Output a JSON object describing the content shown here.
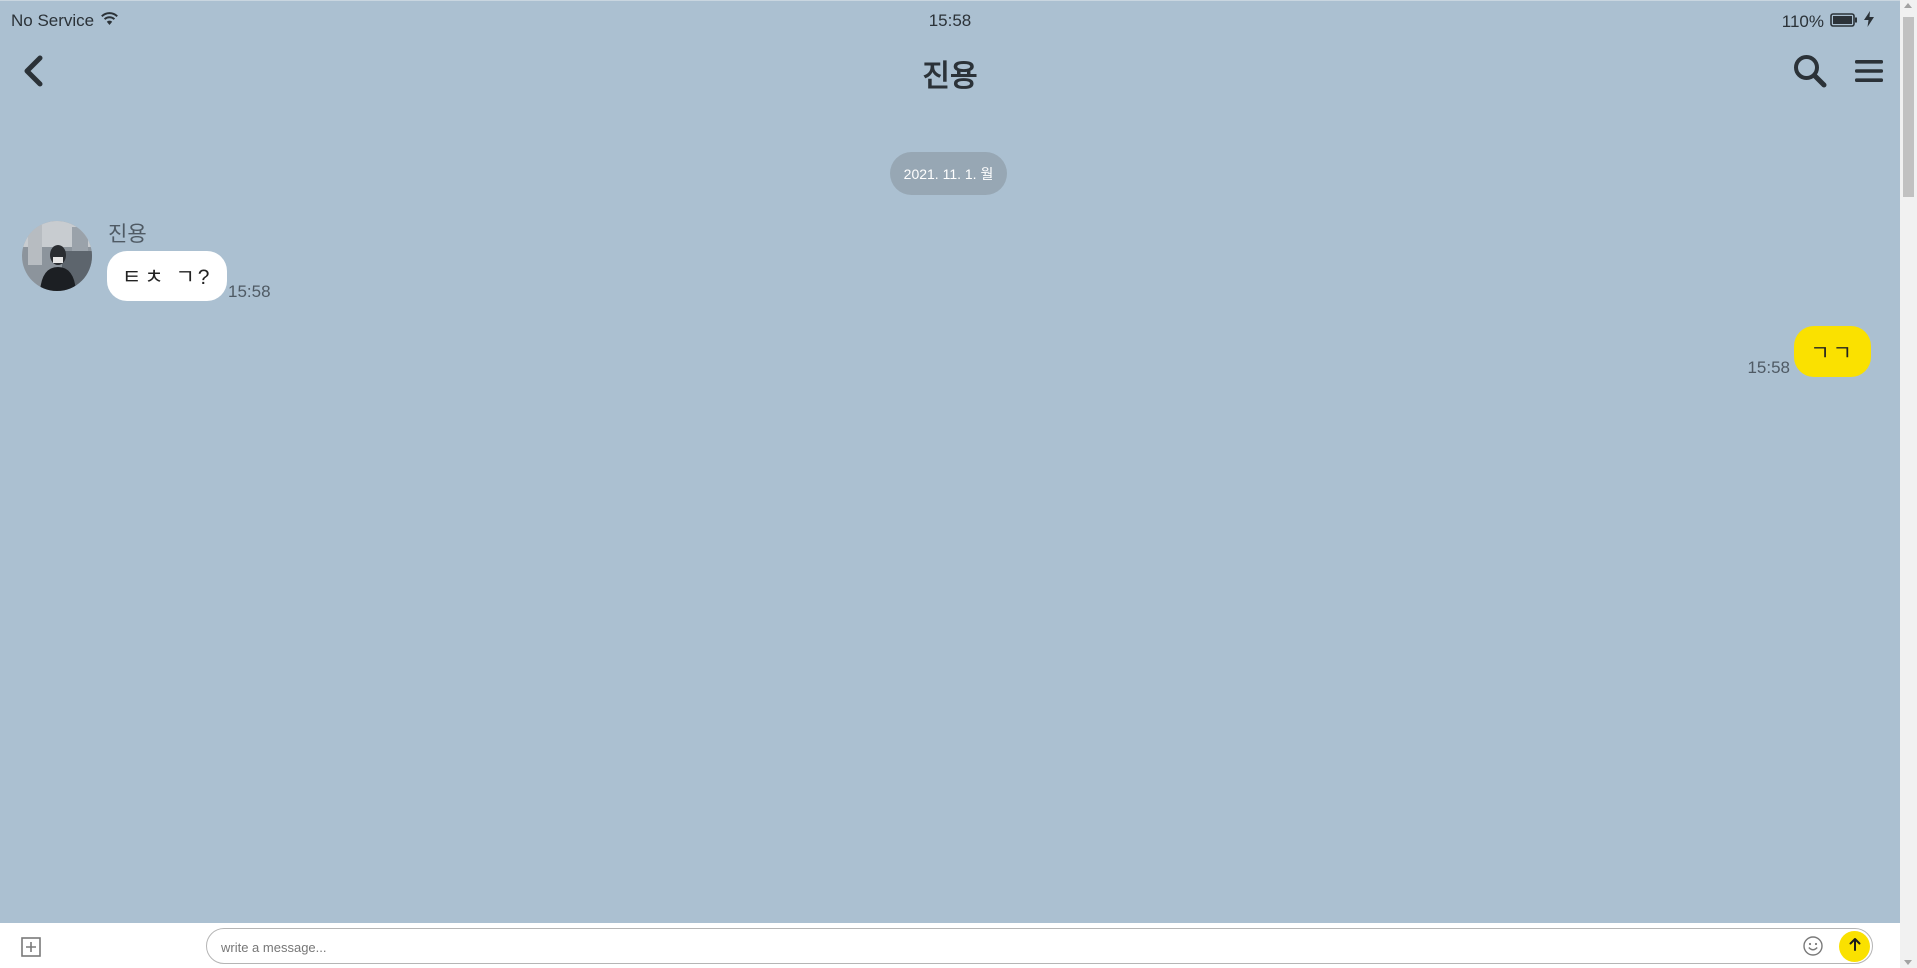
{
  "status_bar": {
    "carrier": "No Service",
    "time": "15:58",
    "battery": "110%"
  },
  "header": {
    "title": "진용",
    "icons": [
      "chevron-left-icon",
      "search-icon",
      "hamburger-menu-icon"
    ]
  },
  "chat": {
    "date_divider": "2021. 11. 1. 월",
    "messages": [
      {
        "direction": "incoming",
        "sender": "진용",
        "text": "ㅌㅊ ㄱ?",
        "time": "15:58"
      },
      {
        "direction": "outgoing",
        "text": "ㄱㄱ",
        "time": "15:58"
      }
    ]
  },
  "composer": {
    "placeholder": "write a message...",
    "icons": [
      "add-square-icon",
      "emoji-icon",
      "send-arrow-icon"
    ]
  },
  "colors": {
    "chat_background": "#abc0d1",
    "incoming_bubble": "#ffffff",
    "outgoing_bubble": "#fae100",
    "send_button": "#fae100",
    "date_pill": "#97a7b4"
  }
}
